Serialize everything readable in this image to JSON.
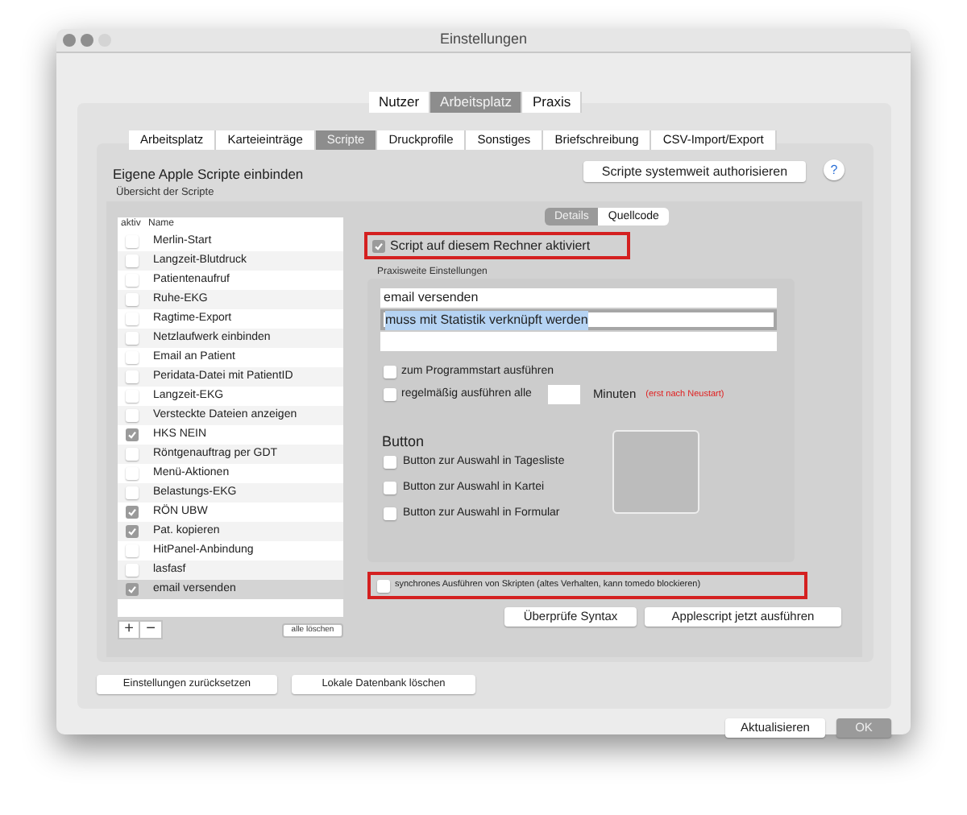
{
  "window": {
    "title": "Einstellungen"
  },
  "top_tabs": [
    {
      "label": "Nutzer",
      "selected": false
    },
    {
      "label": "Arbeitsplatz",
      "selected": true
    },
    {
      "label": "Praxis",
      "selected": false
    }
  ],
  "sub_tabs": [
    {
      "label": "Arbeitsplatz",
      "selected": false
    },
    {
      "label": "Karteieinträge",
      "selected": false
    },
    {
      "label": "Scripte",
      "selected": true
    },
    {
      "label": "Druckprofile",
      "selected": false
    },
    {
      "label": "Sonstiges",
      "selected": false
    },
    {
      "label": "Briefschreibung",
      "selected": false
    },
    {
      "label": "CSV-Import/Export",
      "selected": false
    }
  ],
  "section_title": "Eigene Apple Scripte einbinden",
  "authorize_button": "Scripte systemweit authorisieren",
  "help_button": "?",
  "overview_label": "Übersicht der Scripte",
  "script_list": {
    "columns": [
      "aktiv",
      "Name"
    ],
    "rows": [
      {
        "name": "Merlin-Start",
        "checked": false,
        "selected": false
      },
      {
        "name": "Langzeit-Blutdruck",
        "checked": false,
        "selected": false
      },
      {
        "name": "Patientenaufruf",
        "checked": false,
        "selected": false
      },
      {
        "name": "Ruhe-EKG",
        "checked": false,
        "selected": false
      },
      {
        "name": "Ragtime-Export",
        "checked": false,
        "selected": false
      },
      {
        "name": "Netzlaufwerk einbinden",
        "checked": false,
        "selected": false
      },
      {
        "name": "Email an Patient",
        "checked": false,
        "selected": false
      },
      {
        "name": "Peridata-Datei mit PatientID",
        "checked": false,
        "selected": false
      },
      {
        "name": "Langzeit-EKG",
        "checked": false,
        "selected": false
      },
      {
        "name": "Versteckte Dateien anzeigen",
        "checked": false,
        "selected": false
      },
      {
        "name": "HKS NEIN",
        "checked": true,
        "selected": false
      },
      {
        "name": "Röntgenauftrag per GDT",
        "checked": false,
        "selected": false
      },
      {
        "name": "Menü-Aktionen",
        "checked": false,
        "selected": false
      },
      {
        "name": "Belastungs-EKG",
        "checked": false,
        "selected": false
      },
      {
        "name": "RÖN UBW",
        "checked": true,
        "selected": false
      },
      {
        "name": "Pat. kopieren",
        "checked": true,
        "selected": false
      },
      {
        "name": "HitPanel-Anbindung",
        "checked": false,
        "selected": false
      },
      {
        "name": "lasfasf",
        "checked": false,
        "selected": false
      },
      {
        "name": "email versenden",
        "checked": true,
        "selected": true
      }
    ]
  },
  "list_buttons": [
    "+",
    "−"
  ],
  "clear_button": "alle löschen",
  "detail_tabs": [
    {
      "label": "Details",
      "selected": true
    },
    {
      "label": "Quellcode",
      "selected": false
    }
  ],
  "active_checkbox": {
    "label": "Script auf diesem Rechner aktiviert",
    "checked": true,
    "highlighted": true
  },
  "praxis_label": "Praxisweite Einstellungen",
  "fields": [
    {
      "value": "email versenden",
      "focused": false
    },
    {
      "value": "muss mit Statistik verknüpft werden",
      "focused": true
    },
    {
      "focused": false
    }
  ],
  "start_option": {
    "label": "zum Programmstart ausführen",
    "checked": false
  },
  "interval_option": {
    "label": "regelmäßig ausführen alle",
    "checked": false,
    "unit": "Minuten",
    "note": "(erst nach Neustart)"
  },
  "button_section": {
    "title": "Button",
    "options": [
      {
        "label": "Button zur Auswahl in Tagesliste",
        "checked": false
      },
      {
        "label": "Button zur Auswahl in Kartei",
        "checked": false
      },
      {
        "label": "Button zur Auswahl in Formular",
        "checked": false
      }
    ]
  },
  "sync_option": {
    "label": "synchrones Ausführen von Skripten (altes Verhalten, kann tomedo blockieren)",
    "checked": false,
    "highlighted": true
  },
  "action_buttons": [
    "Überprüfe Syntax",
    "Applescript jetzt ausführen"
  ],
  "bottom_buttons": [
    "Einstellungen zurücksetzen",
    "Lokale Datenbank löschen"
  ],
  "dialog_buttons": [
    {
      "label": "Aktualisieren",
      "default": false
    },
    {
      "label": "OK",
      "default": true
    }
  ]
}
